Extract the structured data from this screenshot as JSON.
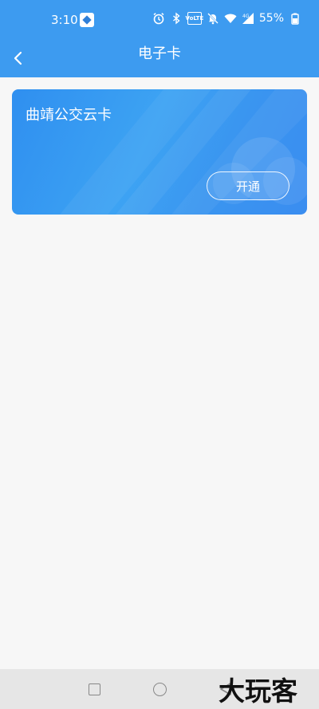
{
  "status_bar": {
    "time": "3:10",
    "battery": "55%",
    "icons": [
      "alarm-icon",
      "bluetooth-icon",
      "volte-icon",
      "mute-icon",
      "wifi-icon",
      "4g-signal-icon",
      "battery-icon"
    ],
    "volte_label": "VoLTE"
  },
  "header": {
    "title": "电子卡",
    "back_icon": "chevron-left-icon",
    "background": "#3d9bf0"
  },
  "cards": [
    {
      "title": "曲靖公交云卡",
      "action_label": "开通"
    }
  ],
  "system_nav": {
    "buttons": [
      "recent-apps",
      "home",
      "back"
    ]
  },
  "watermark": "大玩客"
}
